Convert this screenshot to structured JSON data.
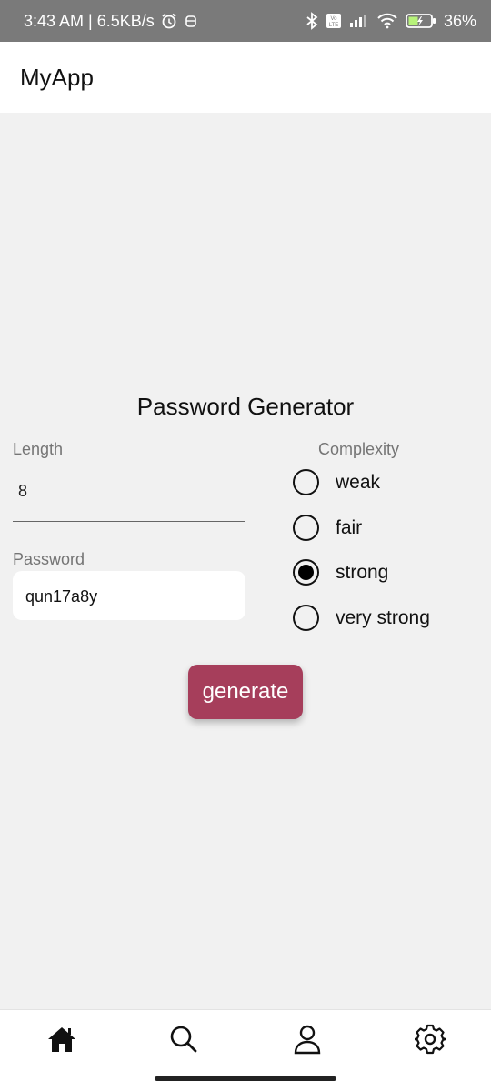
{
  "status_bar": {
    "time_speed": "3:43 AM | 6.5KB/s",
    "battery": "36%",
    "icons": [
      "alarm-icon",
      "notification-icon",
      "bluetooth-icon",
      "volte-icon",
      "signal-icon",
      "wifi-icon",
      "battery-icon"
    ]
  },
  "app_bar": {
    "title": "MyApp"
  },
  "main": {
    "heading": "Password Generator",
    "length": {
      "label": "Length",
      "value": "8"
    },
    "password": {
      "label": "Password",
      "value": "qun17a8y"
    },
    "complexity": {
      "label": "Complexity",
      "options": [
        {
          "label": "weak",
          "selected": false
        },
        {
          "label": "fair",
          "selected": false
        },
        {
          "label": "strong",
          "selected": true
        },
        {
          "label": "very strong",
          "selected": false
        }
      ]
    },
    "generate_label": "generate",
    "accent_color": "#a63e5b"
  },
  "bottom_nav": {
    "items": [
      "home-icon",
      "search-icon",
      "profile-icon",
      "settings-icon"
    ]
  }
}
